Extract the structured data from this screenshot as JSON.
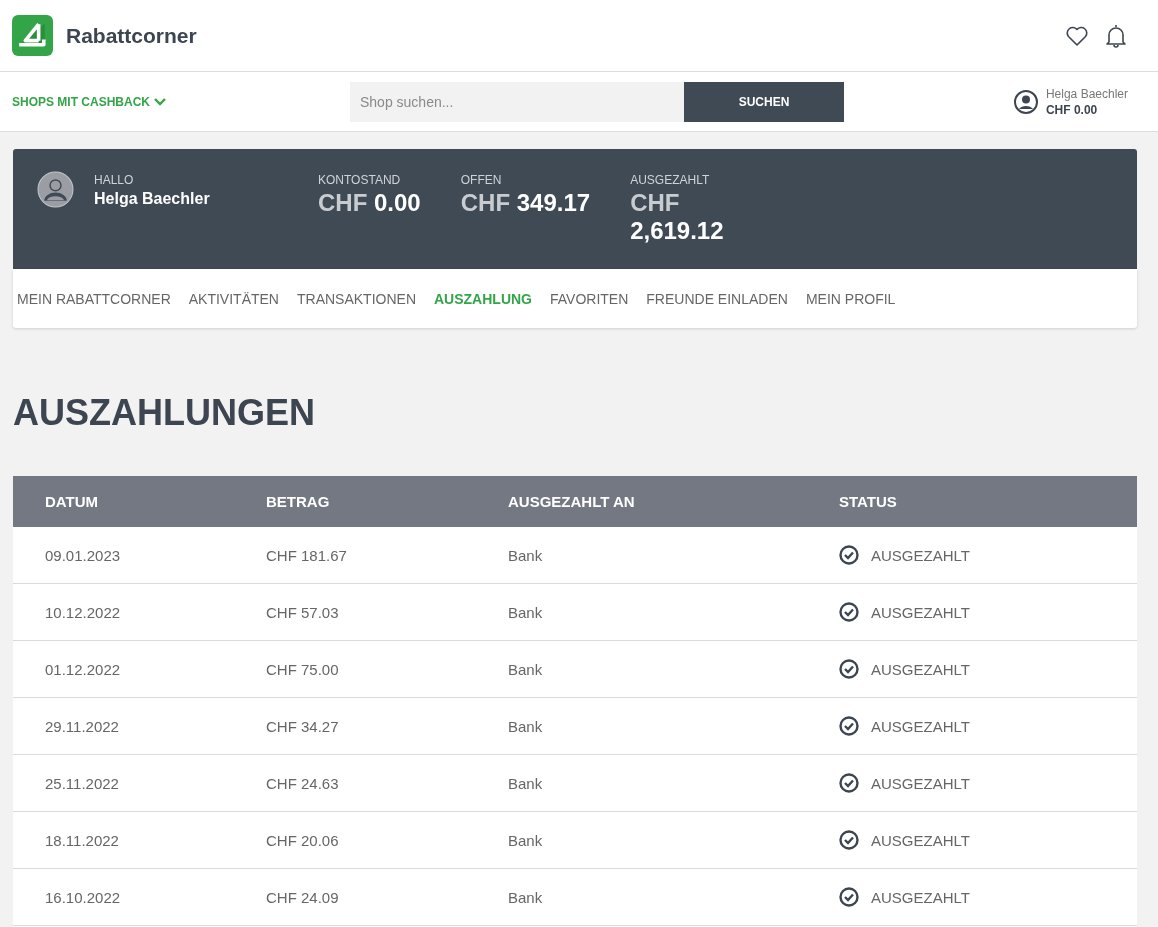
{
  "header": {
    "brand": "Rabattcorner"
  },
  "nav": {
    "shops_menu": "SHOPS MIT CASHBACK",
    "search": {
      "placeholder": "Shop suchen..."
    },
    "search_button": "SUCHEN",
    "user": {
      "name": "Helga Baechler",
      "balance": "CHF 0.00"
    }
  },
  "account": {
    "greeting": "HALLO",
    "name": "Helga Baechler",
    "stats": [
      {
        "label": "KONTOSTAND",
        "currency": "CHF",
        "amount": "0.00"
      },
      {
        "label": "OFFEN",
        "currency": "CHF",
        "amount": "349.17"
      },
      {
        "label": "AUSGEZAHLT",
        "currency": "CHF",
        "amount": "2,619.12"
      }
    ]
  },
  "tabs": [
    {
      "label": "MEIN RABATTCORNER",
      "selected": false
    },
    {
      "label": "AKTIVITÄTEN",
      "selected": false
    },
    {
      "label": "TRANSAKTIONEN",
      "selected": false
    },
    {
      "label": "AUSZAHLUNG",
      "selected": true
    },
    {
      "label": "FAVORITEN",
      "selected": false
    },
    {
      "label": "FREUNDE EINLADEN",
      "selected": false
    },
    {
      "label": "MEIN PROFIL",
      "selected": false
    }
  ],
  "page_title": "AUSZAHLUNGEN",
  "table": {
    "columns": [
      "DATUM",
      "BETRAG",
      "AUSGEZAHLT AN",
      "STATUS"
    ],
    "rows": [
      {
        "date": "09.01.2023",
        "amount": "CHF 181.67",
        "paid_to": "Bank",
        "kind": "paid",
        "status": "AUSGEZAHLT"
      },
      {
        "date": "10.12.2022",
        "amount": "CHF 57.03",
        "paid_to": "Bank",
        "kind": "paid",
        "status": "AUSGEZAHLT"
      },
      {
        "date": "01.12.2022",
        "amount": "CHF 75.00",
        "paid_to": "Bank",
        "kind": "paid",
        "status": "AUSGEZAHLT"
      },
      {
        "date": "29.11.2022",
        "amount": "CHF 34.27",
        "paid_to": "Bank",
        "kind": "paid",
        "status": "AUSGEZAHLT"
      },
      {
        "date": "25.11.2022",
        "amount": "CHF 24.63",
        "paid_to": "Bank",
        "kind": "paid",
        "status": "AUSGEZAHLT"
      },
      {
        "date": "18.11.2022",
        "amount": "CHF 20.06",
        "paid_to": "Bank",
        "kind": "paid",
        "status": "AUSGEZAHLT"
      },
      {
        "date": "16.10.2022",
        "amount": "CHF 24.09",
        "paid_to": "Bank",
        "kind": "paid",
        "status": "AUSGEZAHLT"
      }
    ]
  }
}
